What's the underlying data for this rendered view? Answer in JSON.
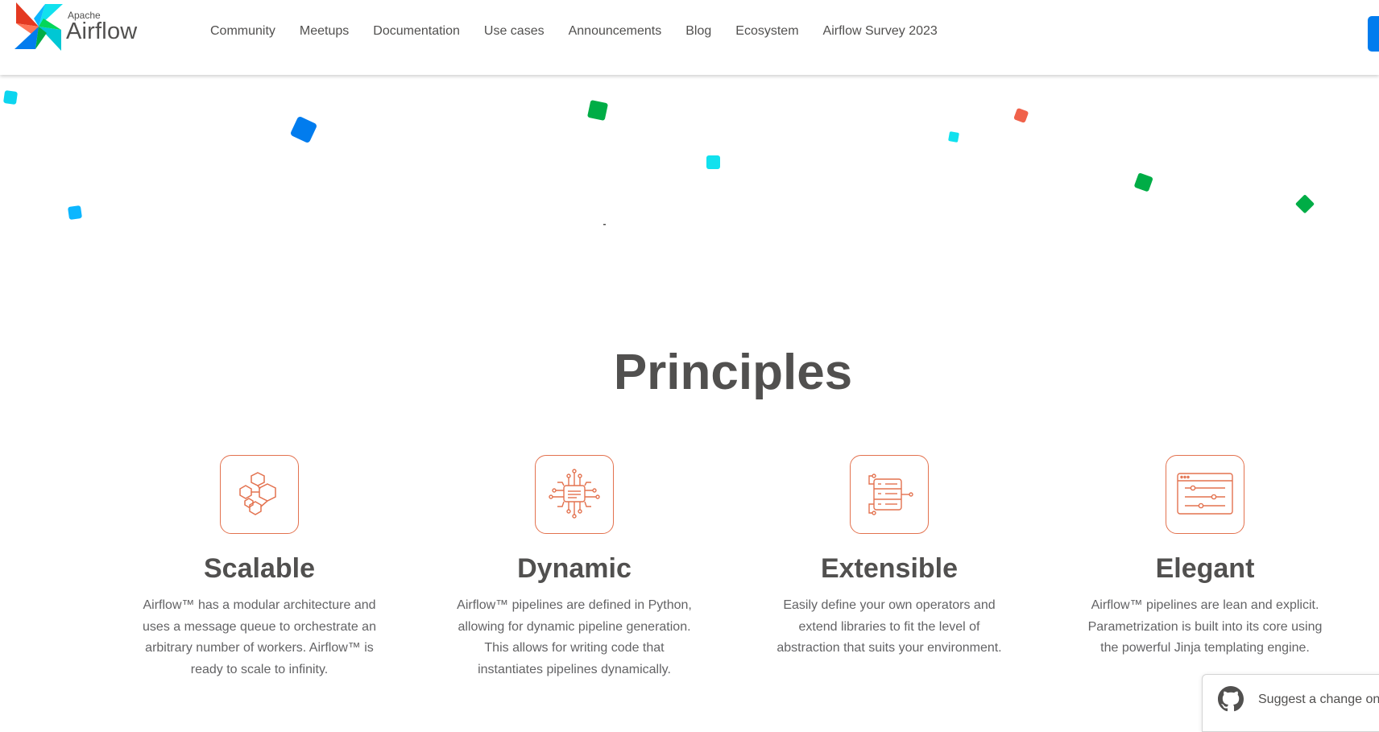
{
  "brand": {
    "apache": "Apache",
    "name": "Airflow"
  },
  "nav": {
    "items": [
      {
        "label": "Community"
      },
      {
        "label": "Meetups"
      },
      {
        "label": "Documentation"
      },
      {
        "label": "Use cases"
      },
      {
        "label": "Announcements"
      },
      {
        "label": "Blog"
      },
      {
        "label": "Ecosystem"
      },
      {
        "label": "Airflow Survey 2023"
      }
    ]
  },
  "principles": {
    "title": "Principles",
    "cards": [
      {
        "icon": "hexagon-cluster-icon",
        "title": "Scalable",
        "description": "Airflow™ has a modular architecture and uses a message queue to orchestrate an arbitrary number of workers. Airflow™ is ready to scale to infinity."
      },
      {
        "icon": "circuit-chip-icon",
        "title": "Dynamic",
        "description": "Airflow™ pipelines are defined in Python, allowing for dynamic pipeline generation. This allows for writing code that instantiates pipelines dynamically."
      },
      {
        "icon": "server-plug-icon",
        "title": "Extensible",
        "description": "Easily define your own operators and extend libraries to fit the level of abstraction that suits your environment."
      },
      {
        "icon": "window-sliders-icon",
        "title": "Elegant",
        "description": "Airflow™ pipelines are lean and explicit. Parametrization is built into its core using the powerful Jinja templating engine."
      }
    ]
  },
  "suggest": {
    "label": "Suggest a change on"
  },
  "colors": {
    "accent": "#e3724f",
    "primary_blue": "#017cee",
    "text": "#51504f",
    "confetti_cyan": "#0cd5ef",
    "confetti_green": "#00ad46",
    "confetti_blue": "#017cee",
    "confetti_red": "#f0624b"
  }
}
